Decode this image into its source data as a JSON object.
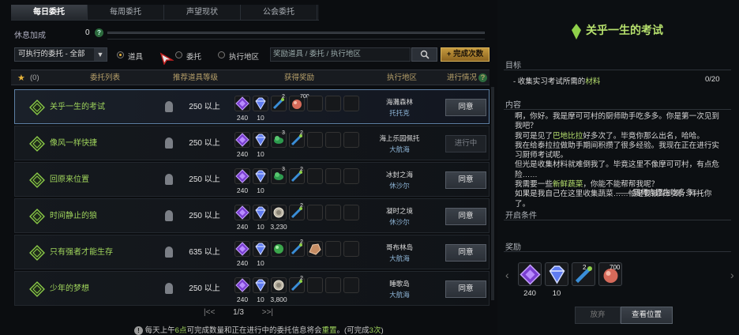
{
  "tabs": [
    "每日委托",
    "每周委托",
    "声望现状",
    "公会委托"
  ],
  "rest": {
    "label": "休息加成",
    "value": "0",
    "help": "?"
  },
  "filter": {
    "select_value": "可执行的委托 - 全部",
    "radio_items": "道具",
    "radio_quest": "委托",
    "radio_area": "执行地区",
    "search_placeholder": "奖励道具 / 委托 / 执行地区",
    "search_icon": "magnifier-icon",
    "add_label": "+ 完成次数"
  },
  "header": {
    "star_count": "(0)",
    "list": "委托列表",
    "level": "推荐道具等级",
    "reward": "获得奖励",
    "area": "执行地区",
    "progress": "进行情况",
    "help": "?"
  },
  "rows": [
    {
      "name": "关乎一生的考试",
      "level": "250 以上",
      "rewards": [
        {
          "icon": "purple-crystal",
          "count": "240"
        },
        {
          "icon": "blue-gem",
          "count": "10"
        },
        {
          "icon": "potion-green",
          "sup": "2"
        },
        {
          "icon": "heart-meat",
          "sup": "700"
        }
      ],
      "area1": "海灘森林",
      "area2": "托托克",
      "action": "同意"
    },
    {
      "name": "像风一样快捷",
      "level": "250 以上",
      "rewards": [
        {
          "icon": "purple-crystal",
          "count": "240"
        },
        {
          "icon": "blue-gem",
          "count": "10"
        },
        {
          "icon": "green-herb",
          "sup": "3"
        },
        {
          "icon": "potion-green",
          "sup": "2"
        }
      ],
      "area1": "海上乐园佩托",
      "area2": "大航海",
      "action": "进行中"
    },
    {
      "name": "回原来位置",
      "level": "250 以上",
      "rewards": [
        {
          "icon": "purple-crystal",
          "count": "240"
        },
        {
          "icon": "blue-gem",
          "count": "10"
        },
        {
          "icon": "green-herb",
          "sup": "3"
        },
        {
          "icon": "potion-green",
          "sup": "2"
        }
      ],
      "area1": "冰封之海",
      "area2": "休沙尔",
      "action": "同意"
    },
    {
      "name": "时间静止的狼",
      "level": "250 以上",
      "rewards": [
        {
          "icon": "purple-crystal",
          "count": "240"
        },
        {
          "icon": "blue-gem",
          "count": "10"
        },
        {
          "icon": "silver-coin",
          "count": "3,230"
        },
        {
          "icon": "potion-green",
          "sup": "2"
        }
      ],
      "area1": "凝时之境",
      "area2": "休沙尔",
      "action": "同意"
    },
    {
      "name": "只有强者才能生存",
      "level": "635 以上",
      "rewards": [
        {
          "icon": "purple-crystal",
          "count": "240"
        },
        {
          "icon": "blue-gem",
          "count": "10"
        },
        {
          "icon": "green-orb"
        },
        {
          "icon": "potion-green",
          "sup": "2"
        },
        {
          "icon": "ore-chunk"
        }
      ],
      "area1": "哥布林岛",
      "area2": "大航海",
      "action": "同意"
    },
    {
      "name": "少年的梦想",
      "level": "250 以上",
      "rewards": [
        {
          "icon": "purple-crystal",
          "count": "240"
        },
        {
          "icon": "blue-gem",
          "count": "10"
        },
        {
          "icon": "silver-coin",
          "count": "3,800"
        },
        {
          "icon": "potion-green",
          "sup": "2"
        }
      ],
      "area1": "睡歌岛",
      "area2": "大航海",
      "action": "同意"
    }
  ],
  "pager": {
    "first": "|<<",
    "page": "1/3",
    "last": ">>|"
  },
  "notice": {
    "prefix": "每天上午",
    "time": "6点",
    "mid": "可完成数量和正在进行中的委托信息将会",
    "reset": "重置",
    "suffix": "。(可完成",
    "count": "3次",
    "end": ")"
  },
  "detail": {
    "title": "关乎一生的考试",
    "goal_head": "目标",
    "goal_prefix": "- 收集实习考试所需的",
    "goal_hl": "材料",
    "goal_value": "0/20",
    "content_head": "内容",
    "content_lines": [
      "啊，你好。我是摩可可村的厨师助手吃多多。你是第一次见到我吧？",
      "我可是见了巴地比拉好多次了。毕竟你那么出名，哈哈。",
      "我在给泰拉拉做助手期间积攒了很多经验。我现在正在进行实习厨师考试呢。",
      "但光是收集材料就难倒我了。毕竟这里不像摩可可村，有点危险……",
      "我需要一些新鲜蔬菜，你能不能帮帮我呢？",
      "如果是我自己在这里收集蔬菜……怕是要被踩到啊，拜托你了。"
    ],
    "signature": "—— 厨师志愿生吃多多 —",
    "cond_head": "开启条件",
    "reward_head": "奖励",
    "rewards": [
      {
        "icon": "purple-crystal",
        "count": "240"
      },
      {
        "icon": "blue-gem",
        "count": "10"
      },
      {
        "icon": "potion-green",
        "sup": "2"
      },
      {
        "icon": "heart-meat",
        "sup": "700"
      }
    ],
    "giveup": "放弃",
    "view": "查看位置"
  },
  "colors": {
    "accent_green": "#9fd45c",
    "gold": "#c59a3e",
    "select_border": "#5d7fa3"
  }
}
